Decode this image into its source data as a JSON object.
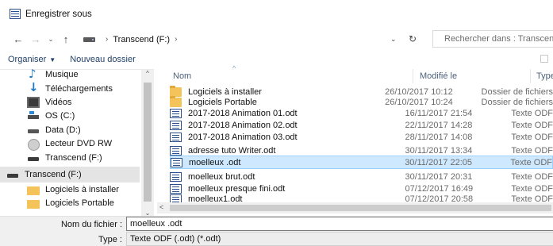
{
  "window": {
    "title": "Enregistrer sous"
  },
  "addressbar": {
    "back": "←",
    "forward": "→",
    "recent": "⌄",
    "up": "↑",
    "path_sep": "›",
    "path": [
      "Transcend (F:)"
    ],
    "path_trailing_sep": "›",
    "dropdown": "⌄",
    "refresh": "↻",
    "search_placeholder": "Rechercher dans : Transcend (F:)"
  },
  "toolbar": {
    "organize_label": "Organiser",
    "organize_caret": "▼",
    "new_folder_label": "Nouveau dossier"
  },
  "sidebar": {
    "items": [
      {
        "label": "Musique",
        "icon": "music-icon"
      },
      {
        "label": "Téléchargements",
        "icon": "download-icon"
      },
      {
        "label": "Vidéos",
        "icon": "video-icon"
      },
      {
        "label": "OS (C:)",
        "icon": "os-drive-icon"
      },
      {
        "label": "Data (D:)",
        "icon": "drive-icon"
      },
      {
        "label": "Lecteur DVD RW",
        "icon": "dvd-icon"
      },
      {
        "label": "Transcend (F:)",
        "icon": "usb-drive-icon"
      },
      {
        "label": "Transcend (F:)",
        "icon": "usb-drive-icon",
        "selected": true
      },
      {
        "label": "Logiciels à installer",
        "icon": "folder-icon"
      },
      {
        "label": "Logiciels Portable",
        "icon": "folder-icon"
      }
    ],
    "scroll_up": "^",
    "scroll_down": "⌄"
  },
  "columns": {
    "name": "Nom",
    "date": "Modifié le",
    "type": "Type",
    "sort_indicator": "^"
  },
  "files": [
    {
      "name": "Logiciels à installer",
      "date": "26/10/2017 10:12",
      "type": "Dossier de fichiers",
      "kind": "folder"
    },
    {
      "name": "Logiciels Portable",
      "date": "26/10/2017 10:24",
      "type": "Dossier de fichiers",
      "kind": "folder"
    },
    {
      "name": "2017-2018 Animation 01.odt",
      "date": "16/11/2017 21:54",
      "type": "Texte ODF",
      "kind": "doc"
    },
    {
      "name": "2017-2018 Animation 02.odt",
      "date": "22/11/2017 14:28",
      "type": "Texte ODF",
      "kind": "doc"
    },
    {
      "name": "2017-2018 Animation 03.odt",
      "date": "28/11/2017 14:08",
      "type": "Texte ODF",
      "kind": "doc"
    },
    {
      "name": "adresse tuto Writer.odt",
      "date": "30/11/2017 13:34",
      "type": "Texte ODF",
      "kind": "doc"
    },
    {
      "name": "moelleux .odt",
      "date": "30/11/2017 22:05",
      "type": "Texte ODF",
      "kind": "doc",
      "selected": true
    },
    {
      "name": "moelleux brut.odt",
      "date": "30/11/2017 20:31",
      "type": "Texte ODF",
      "kind": "doc"
    },
    {
      "name": "moelleux presque fini.odt",
      "date": "07/12/2017 16:49",
      "type": "Texte ODF",
      "kind": "doc"
    },
    {
      "name": "moelleux1.odt",
      "date": "07/12/2017 20:58",
      "type": "Texte ODF",
      "kind": "doc"
    }
  ],
  "hscroll": {
    "left_arrow": "<"
  },
  "form": {
    "filename_label": "Nom du fichier :",
    "filename_value": "moelleux .odt",
    "type_label": "Type :",
    "type_value": "Texte ODF (.odt) (*.odt)"
  }
}
